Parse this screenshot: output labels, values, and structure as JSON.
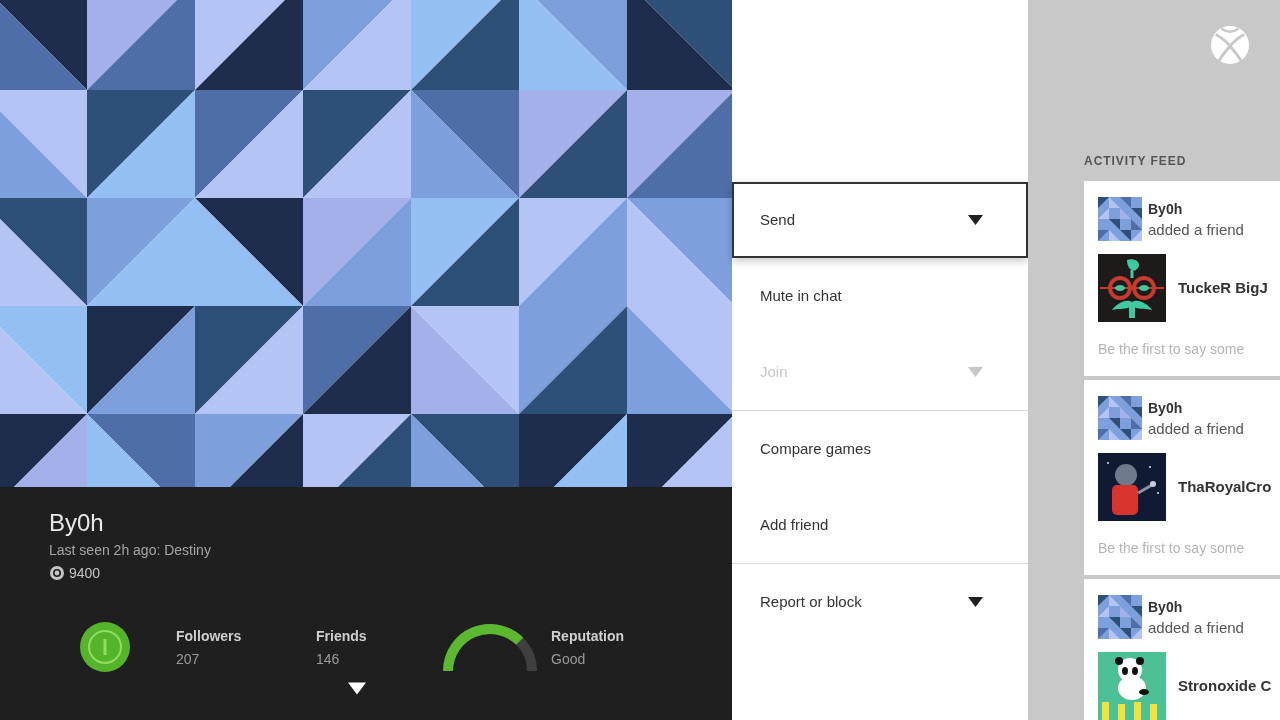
{
  "profile": {
    "gamertag": "By0h",
    "last_seen": "Last seen 2h ago: Destiny",
    "gamerscore": "9400",
    "stats": [
      {
        "label": "Followers",
        "value": "207"
      },
      {
        "label": "Friends",
        "value": "146"
      }
    ],
    "reputation": {
      "label": "Reputation",
      "value": "Good",
      "level": 0.75
    }
  },
  "menu": {
    "groups": [
      {
        "items": [
          {
            "label": "Send",
            "selected": true,
            "disabled": false,
            "dropdown": true
          },
          {
            "label": "Mute in chat",
            "selected": false,
            "disabled": false,
            "dropdown": false
          },
          {
            "label": "Join",
            "selected": false,
            "disabled": true,
            "dropdown": true
          }
        ]
      },
      {
        "items": [
          {
            "label": "Compare games",
            "selected": false,
            "disabled": false,
            "dropdown": false
          },
          {
            "label": "Add friend",
            "selected": false,
            "disabled": false,
            "dropdown": false
          }
        ]
      },
      {
        "items": [
          {
            "label": "Report or block",
            "selected": false,
            "disabled": false,
            "dropdown": true
          }
        ]
      }
    ]
  },
  "activity_feed": {
    "title": "ACTIVITY FEED",
    "items": [
      {
        "user": "By0h",
        "action": "added a friend",
        "friend": "TuckeR BigJ",
        "prompt": "Be the first to say some"
      },
      {
        "user": "By0h",
        "action": "added a friend",
        "friend": "ThaRoyalCro",
        "prompt": "Be the first to say some"
      },
      {
        "user": "By0h",
        "action": "added a friend",
        "friend": "Stronoxide C"
      }
    ]
  }
}
